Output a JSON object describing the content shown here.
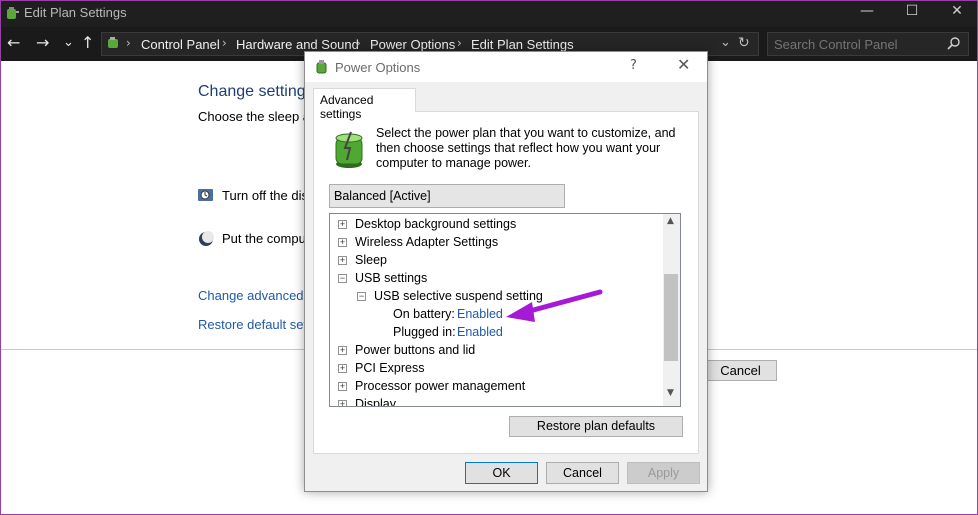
{
  "window": {
    "title": "Edit Plan Settings",
    "minimize": "—",
    "maximize": "☐",
    "close": "✕"
  },
  "address": {
    "back": "←",
    "forward": "→",
    "recent": "⌄",
    "up": "↑",
    "breadcrumbs": [
      "Control Panel",
      "Hardware and Sound",
      "Power Options",
      "Edit Plan Settings"
    ],
    "refresh": "↻",
    "dropdown": "⌄"
  },
  "search": {
    "placeholder": "Search Control Panel"
  },
  "background": {
    "heading": "Change settings",
    "subtitle": "Choose the sleep and",
    "display_label": "Turn off the disp",
    "sleep_label": "Put the comput",
    "advanced_link": "Change advanced po",
    "restore_link": "Restore default settin",
    "cancel": "Cancel"
  },
  "dialog": {
    "title": "Power Options",
    "help": "?",
    "close": "✕",
    "tab": "Advanced settings",
    "intro": "Select the power plan that you want to customize, and then choose settings that reflect how you want your computer to manage power.",
    "plan": "Balanced [Active]",
    "tree": {
      "desktop_bg": "Desktop background settings",
      "wireless": "Wireless Adapter Settings",
      "sleep": "Sleep",
      "usb": "USB settings",
      "usb_suspend": "USB selective suspend setting",
      "on_battery_label": "On battery:",
      "on_battery_value": "Enabled",
      "plugged_in_label": "Plugged in:",
      "plugged_in_value": "Enabled",
      "power_buttons": "Power buttons and lid",
      "pci": "PCI Express",
      "processor": "Processor power management",
      "display": "Display"
    },
    "restore_defaults": "Restore plan defaults",
    "ok": "OK",
    "cancel": "Cancel",
    "apply": "Apply"
  },
  "colors": {
    "link": "#1e5aa6",
    "arrow": "#a51ad6",
    "titlebar": "#1f1f1f"
  }
}
